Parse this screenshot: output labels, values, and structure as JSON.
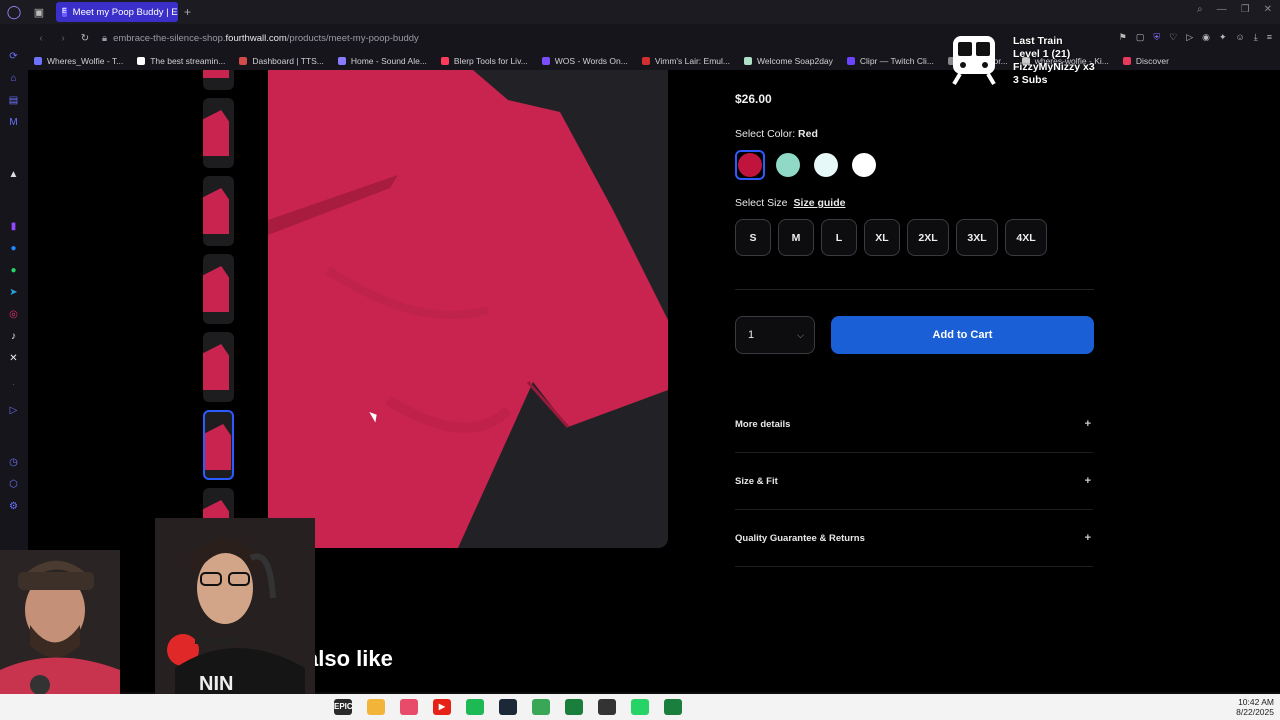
{
  "browser": {
    "tab_title": "Meet my Poop Buddy | Em",
    "tab_favicon": "E",
    "url_prefix": "embrace-the-silence-shop.",
    "url_host": "fourthwall.com",
    "url_path": "/products/meet-my-poop-buddy",
    "bookmarks": [
      {
        "label": "Wheres_Wolfie - T...",
        "color": "#6b73ff"
      },
      {
        "label": "The best streamin...",
        "color": "#ffffff"
      },
      {
        "label": "Dashboard | TTS...",
        "color": "#d14b4b"
      },
      {
        "label": "Home - Sound Ale...",
        "color": "#8a7cff"
      },
      {
        "label": "Blerp Tools for Liv...",
        "color": "#ff3b5c"
      },
      {
        "label": "WOS - Words On...",
        "color": "#7b4dff"
      },
      {
        "label": "Vimm's Lair: Emul...",
        "color": "#d12f2f"
      },
      {
        "label": "Welcome Soap2day",
        "color": "#aee0c8"
      },
      {
        "label": "Clipr — Twitch Cli...",
        "color": "#6a44ff"
      },
      {
        "label": "a result for...",
        "color": "#888888"
      },
      {
        "label": "wheres-wolfie - Ki...",
        "color": "#cccccc"
      },
      {
        "label": "Discover",
        "color": "#e83a5a"
      }
    ]
  },
  "product": {
    "price": "$26.00",
    "color_label": "Select Color:",
    "color_value": "Red",
    "colors": [
      {
        "name": "Red",
        "hex": "#c0143c",
        "selected": true
      },
      {
        "name": "Mint",
        "hex": "#8fd9c6",
        "selected": false
      },
      {
        "name": "Ice",
        "hex": "#e6f8f8",
        "selected": false
      },
      {
        "name": "White",
        "hex": "#ffffff",
        "selected": false
      }
    ],
    "size_label": "Select Size",
    "size_guide": "Size guide",
    "sizes": [
      "S",
      "M",
      "L",
      "XL",
      "2XL",
      "3XL",
      "4XL"
    ],
    "quantity": "1",
    "add_to_cart": "Add to Cart",
    "accordions": [
      {
        "label": "More details"
      },
      {
        "label": "Size & Fit"
      },
      {
        "label": "Quality Guarantee & Returns"
      }
    ],
    "also_like": "also like"
  },
  "overlay": {
    "line1": "Last Train",
    "line2": "Level 1  (21)",
    "line3": "FizzyMyNizzy x3",
    "line4": "3 Subs"
  },
  "taskbar": {
    "time": "10:42 AM",
    "date": "8/22/2025",
    "apps": [
      {
        "name": "epic-games",
        "label": "EPIC",
        "color": "#2a2a2a"
      },
      {
        "name": "file-explorer",
        "label": "",
        "color": "#f2b53a"
      },
      {
        "name": "maps",
        "label": "",
        "color": "#e84a6a"
      },
      {
        "name": "youtube",
        "label": "▶",
        "color": "#e62117"
      },
      {
        "name": "spotify",
        "label": "",
        "color": "#1db954"
      },
      {
        "name": "steam",
        "label": "",
        "color": "#1b2838"
      },
      {
        "name": "xbox",
        "label": "",
        "color": "#3aa757"
      },
      {
        "name": "streamer-app",
        "label": "",
        "color": "#1a7f3c"
      },
      {
        "name": "obs",
        "label": "",
        "color": "#333333"
      },
      {
        "name": "whatsapp",
        "label": "",
        "color": "#25d366"
      },
      {
        "name": "streamer-app-2",
        "label": "",
        "color": "#1a7f3c"
      }
    ]
  }
}
